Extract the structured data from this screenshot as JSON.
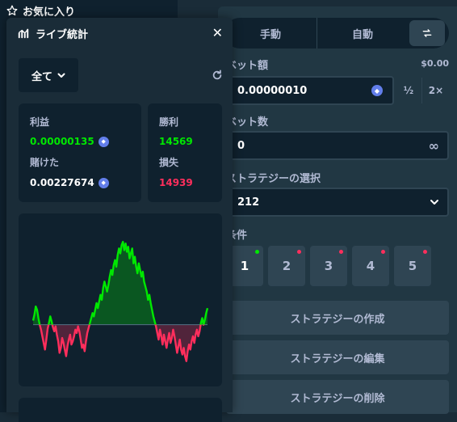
{
  "sidebar": {
    "favorites_label": "お気に入り"
  },
  "bet_panel": {
    "tabs": {
      "manual": "手動",
      "auto": "自動"
    },
    "bet_amount": {
      "label": "ベット額",
      "usd": "$0.00",
      "value": "0.00000010",
      "half": "½",
      "double": "2×"
    },
    "bet_count": {
      "label": "ベット数",
      "value": "0"
    },
    "strategy": {
      "label": "ストラテジーの選択",
      "value": "212"
    },
    "conditions": {
      "label": "条件",
      "items": [
        {
          "num": "1",
          "status": "green"
        },
        {
          "num": "2",
          "status": "red"
        },
        {
          "num": "3",
          "status": "red"
        },
        {
          "num": "4",
          "status": "red"
        },
        {
          "num": "5",
          "status": "red"
        }
      ]
    },
    "actions": {
      "create": "ストラテジーの作成",
      "edit": "ストラテジーの編集",
      "delete": "ストラテジーの削除"
    }
  },
  "live_stats": {
    "title": "ライブ統計",
    "filter": "全て",
    "profit_label": "利益",
    "profit_value": "0.00000135",
    "wagered_label": "賭けた",
    "wagered_value": "0.00227674",
    "wins_label": "勝利",
    "wins_value": "14569",
    "losses_label": "損失",
    "losses_value": "14939"
  },
  "colors": {
    "profit": "#00e701",
    "loss": "#ff2e5c",
    "accent": "#627eea"
  },
  "chart_data": {
    "type": "area",
    "title": "",
    "xlabel": "",
    "ylabel": "",
    "baseline": 0,
    "ylim": [
      -55,
      105
    ],
    "values": [
      5,
      12,
      22,
      18,
      8,
      0,
      -6,
      -14,
      -22,
      -30,
      -18,
      -5,
      2,
      10,
      4,
      -3,
      -8,
      -2,
      -12,
      -20,
      -34,
      -28,
      -16,
      -22,
      -30,
      -38,
      -26,
      -18,
      -12,
      -24,
      -20,
      -14,
      -6,
      -10,
      -2,
      -8,
      -18,
      -28,
      -24,
      -32,
      -20,
      -10,
      -4,
      2,
      8,
      14,
      10,
      18,
      26,
      20,
      28,
      36,
      30,
      44,
      52,
      46,
      40,
      48,
      58,
      66,
      60,
      72,
      78,
      70,
      84,
      92,
      86,
      96,
      100,
      90,
      98,
      88,
      94,
      80,
      86,
      92,
      74,
      82,
      70,
      62,
      74,
      66,
      58,
      64,
      52,
      46,
      40,
      30,
      36,
      26,
      18,
      10,
      4,
      -2,
      -10,
      -18,
      -6,
      -14,
      -24,
      -12,
      -20,
      -28,
      -18,
      -10,
      -22,
      -16,
      -6,
      -14,
      -24,
      -34,
      -26,
      -18,
      -30,
      -36,
      -28,
      -38,
      -44,
      -32,
      -24,
      -30,
      -20,
      -14,
      -22,
      -12,
      -6,
      -14,
      -8,
      2,
      8,
      0,
      6,
      14,
      20
    ]
  }
}
